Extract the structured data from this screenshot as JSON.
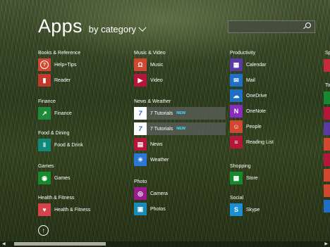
{
  "header": {
    "title": "Apps",
    "sort_label": "by category"
  },
  "search": {
    "placeholder": ""
  },
  "groups": [
    {
      "name": "Books & Reference",
      "items": [
        {
          "label": "Help+Tips",
          "icon": "help-icon",
          "color": "#d2472f",
          "glyph": "?"
        },
        {
          "label": "Reader",
          "icon": "reader-icon",
          "color": "#c1392b",
          "glyph": "R"
        }
      ]
    },
    {
      "name": "Finance",
      "items": [
        {
          "label": "Finance",
          "icon": "finance-chart-icon",
          "color": "#1f8a3a",
          "glyph": "↗"
        }
      ]
    },
    {
      "name": "Food & Dining",
      "items": [
        {
          "label": "Food & Drink",
          "icon": "fork-knife-icon",
          "color": "#0f8a7a",
          "glyph": "ǁ"
        }
      ]
    },
    {
      "name": "Games",
      "items": [
        {
          "label": "Games",
          "icon": "gamepad-icon",
          "color": "#178a2e",
          "glyph": "◉"
        }
      ]
    },
    {
      "name": "Health & Fitness",
      "items": [
        {
          "label": "Health & Fitness",
          "icon": "heart-icon",
          "color": "#d9424a",
          "glyph": "♥"
        }
      ]
    },
    {
      "name": "Music & Video",
      "items": [
        {
          "label": "Music",
          "icon": "headphones-icon",
          "color": "#d2472f",
          "glyph": "Ω"
        },
        {
          "label": "Video",
          "icon": "video-icon",
          "color": "#b5163a",
          "glyph": "▶"
        }
      ]
    },
    {
      "name": "News & Weather",
      "items": [
        {
          "label": "7 Tutorials",
          "badge": "NEW",
          "icon": "7tutorials-icon",
          "color": "#ffffff",
          "glyph": "7"
        },
        {
          "label": "7 Tutorials",
          "badge": "NEW",
          "icon": "7tutorials-icon",
          "color": "#ffffff",
          "glyph": "7"
        },
        {
          "label": "News",
          "icon": "news-icon",
          "color": "#b5163a",
          "glyph": "▤"
        },
        {
          "label": "Weather",
          "icon": "sun-icon",
          "color": "#2b78d4",
          "glyph": "☀"
        }
      ]
    },
    {
      "name": "Photo",
      "items": [
        {
          "label": "Camera",
          "icon": "camera-icon",
          "color": "#9b1b8f",
          "glyph": "◎"
        },
        {
          "label": "Photos",
          "icon": "photos-icon",
          "color": "#1b8ab5",
          "glyph": "▣"
        }
      ]
    },
    {
      "name": "Productivity",
      "items": [
        {
          "label": "Calendar",
          "icon": "calendar-icon",
          "color": "#5b3ba3",
          "glyph": "▦"
        },
        {
          "label": "Mail",
          "icon": "mail-icon",
          "color": "#1f6fc9",
          "glyph": "✉"
        },
        {
          "label": "OneDrive",
          "icon": "cloud-icon",
          "color": "#1f6fc9",
          "glyph": "☁"
        },
        {
          "label": "OneNote",
          "icon": "onenote-icon",
          "color": "#8a2bbf",
          "glyph": "N"
        },
        {
          "label": "People",
          "icon": "people-icon",
          "color": "#d2472f",
          "glyph": "☺"
        },
        {
          "label": "Reading List",
          "icon": "reading-list-icon",
          "color": "#b5163a",
          "glyph": "≡"
        }
      ]
    },
    {
      "name": "Shopping",
      "items": [
        {
          "label": "Store",
          "icon": "store-icon",
          "color": "#178a2e",
          "glyph": "▩"
        }
      ]
    },
    {
      "name": "Social",
      "items": [
        {
          "label": "Skype",
          "icon": "skype-icon",
          "color": "#1a8fd6",
          "glyph": "S"
        }
      ]
    }
  ],
  "partial_headers": {
    "col4_a": "Sp",
    "col4_b": "To"
  },
  "edge_tiles": [
    "#c62b3a",
    "#178a2e",
    "#b5163a",
    "#5b3ba3",
    "#d2472f",
    "#b5163a",
    "#d2472f",
    "#d2472f",
    "#1f6fc9"
  ],
  "scrollbar": {
    "left": "◀",
    "right": "▶"
  }
}
